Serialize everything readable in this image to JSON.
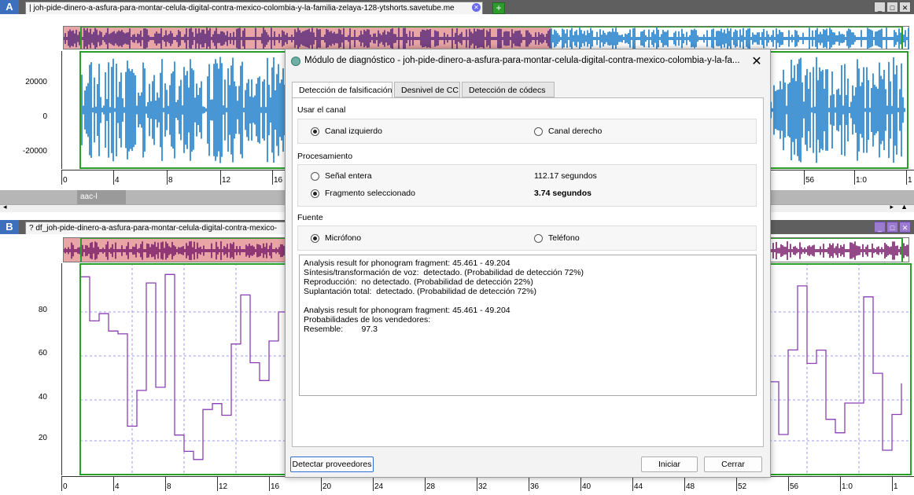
{
  "panelA": {
    "letter": "A",
    "tab_title": "| joh-pide-dinero-a-asfura-para-montar-celula-digital-contra-mexico-colombia-y-la-familia-zelaya-128-ytshorts.savetube.me",
    "y_ticks": [
      "20000",
      "0",
      "-20000"
    ],
    "time_ticks": [
      "0",
      "4",
      "8",
      "12",
      "16",
      "56",
      "1:0",
      "1"
    ],
    "status_label": "aac-l",
    "waveform_color": "#1a7cc9"
  },
  "panelB": {
    "letter": "B",
    "tab_title": "? df_joh-pide-dinero-a-asfura-para-montar-celula-digital-contra-mexico-",
    "y_ticks": [
      "80",
      "60",
      "40",
      "20"
    ],
    "time_ticks": [
      "0",
      "4",
      "8",
      "12",
      "16",
      "20",
      "24",
      "28",
      "32",
      "36",
      "40",
      "44",
      "48",
      "52",
      "56",
      "1:0",
      "1"
    ],
    "plot_color": "#8a3fb8"
  },
  "dialog": {
    "title": "Módulo de diagnóstico - joh-pide-dinero-a-asfura-para-montar-celula-digital-contra-mexico-colombia-y-la-fa...",
    "tabs": [
      "Detección de falsificación",
      "Desnivel de CC",
      "Detección de códecs"
    ],
    "channel": {
      "label": "Usar el canal",
      "left": "Canal izquierdo",
      "right": "Canal derecho"
    },
    "processing": {
      "label": "Procesamiento",
      "whole": "Señal entera",
      "whole_value": "112.17 segundos",
      "fragment": "Fragmento seleccionado",
      "fragment_value": "3.74 segundos"
    },
    "source": {
      "label": "Fuente",
      "mic": "Micrófono",
      "phone": "Teléfono"
    },
    "result_lines": [
      "Analysis result for phonogram fragment: 45.461 - 49.204",
      "Síntesis/transformación de voz:  detectado. (Probabilidad de detección 72%)",
      "Reproducción:  no detectado. (Probabilidad de detección 22%)",
      "Suplantación total:  detectado. (Probabilidad de detección 72%)",
      "",
      "Analysis result for phonogram fragment: 45.461 - 49.204",
      "Probabilidades de los vendedores:",
      "Resemble:        97.3"
    ],
    "buttons": {
      "detect": "Detectar proveedores",
      "start": "Iniciar",
      "close": "Cerrar"
    }
  }
}
